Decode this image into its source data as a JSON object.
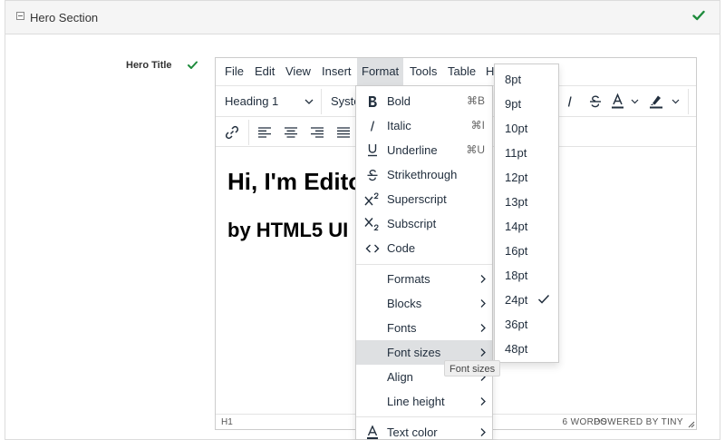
{
  "section": {
    "title": "Hero Section"
  },
  "field": {
    "label": "Hero Title"
  },
  "menubar": [
    "File",
    "Edit",
    "View",
    "Insert",
    "Format",
    "Tools",
    "Table",
    "H"
  ],
  "toolbar": {
    "block_format": "Heading 1",
    "font_family": "Syste"
  },
  "content": {
    "heading1": "Hi, I'm Edito",
    "heading2": "by HTML5 UI"
  },
  "statusbar": {
    "path": "H1",
    "word_count": "6 WORDS",
    "powered": "POWERED BY TINY"
  },
  "format_menu": [
    {
      "label": "Bold",
      "shortcut": "⌘B",
      "icon": "bold-icon"
    },
    {
      "label": "Italic",
      "shortcut": "⌘I",
      "icon": "italic-icon"
    },
    {
      "label": "Underline",
      "shortcut": "⌘U",
      "icon": "underline-icon"
    },
    {
      "label": "Strikethrough",
      "shortcut": "",
      "icon": "strikethrough-icon"
    },
    {
      "label": "Superscript",
      "shortcut": "",
      "icon": "superscript-icon"
    },
    {
      "label": "Subscript",
      "shortcut": "",
      "icon": "subscript-icon"
    },
    {
      "label": "Code",
      "shortcut": "",
      "icon": "code-icon"
    },
    {
      "label": "Formats"
    },
    {
      "label": "Blocks"
    },
    {
      "label": "Fonts"
    },
    {
      "label": "Font sizes"
    },
    {
      "label": "Align"
    },
    {
      "label": "Line height"
    },
    {
      "label": "Text color",
      "icon": "text-color-icon"
    }
  ],
  "font_sizes": [
    "8pt",
    "9pt",
    "10pt",
    "11pt",
    "12pt",
    "13pt",
    "14pt",
    "16pt",
    "18pt",
    "24pt",
    "36pt",
    "48pt"
  ],
  "font_sizes_selected": "24pt",
  "tooltip": "Font sizes",
  "colors": {
    "check_green": "#1e8b3c",
    "hover_bg": "#dee0e2",
    "text": "#222f3e"
  }
}
